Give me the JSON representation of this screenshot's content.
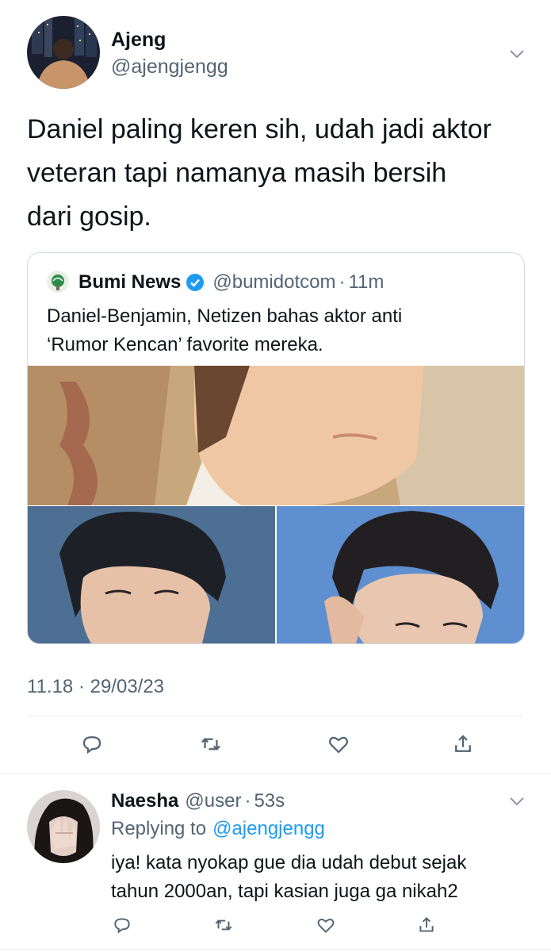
{
  "tweet": {
    "display_name": "Ajeng",
    "handle": "@ajengjengg",
    "text_lines": [
      "Daniel paling keren sih, udah jadi aktor",
      "veteran tapi namanya masih bersih",
      "dari gosip."
    ],
    "timestamp": "11.18 · 29/03/23"
  },
  "quote": {
    "display_name": "Bumi News",
    "handle": "@bumidotcom",
    "separator": "·",
    "time": "11m",
    "text_lines": [
      "Daniel-Benjamin, Netizen bahas aktor anti",
      "‘Rumor Kencan’ favorite mereka."
    ]
  },
  "reply": {
    "display_name": "Naesha",
    "handle": "@user",
    "separator": "·",
    "time": "53s",
    "replying_prefix": "Replying to",
    "replying_handle": "@ajengjengg",
    "text_lines": [
      "iya! kata nyokap gue dia udah debut sejak",
      "tahun 2000an, tapi kasian juga ga nikah2"
    ]
  },
  "icons": {
    "reply": "reply-icon",
    "retweet": "retweet-icon",
    "like": "heart-icon",
    "share": "share-icon",
    "more": "chevron-down-icon",
    "verified": "verified-badge-icon"
  },
  "colors": {
    "primary_text": "#0f1419",
    "muted_text": "#536471",
    "link": "#1d9bf0",
    "border": "#cfd9de"
  }
}
